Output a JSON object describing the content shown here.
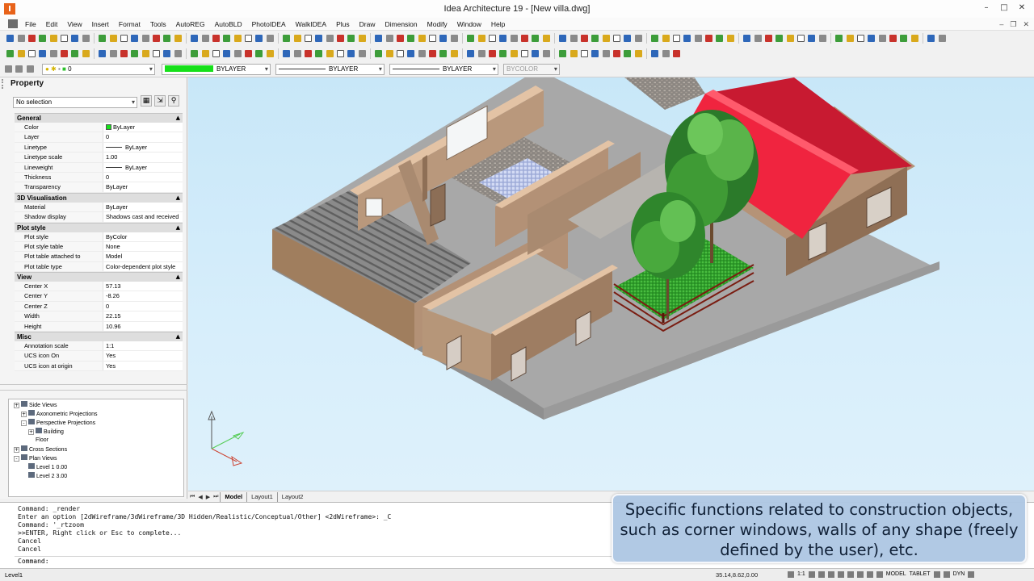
{
  "window": {
    "title": "Idea Architecture 19 - [New villa.dwg]",
    "logo_letter": "I"
  },
  "menu": [
    "File",
    "Edit",
    "View",
    "Insert",
    "Format",
    "Tools",
    "AutoREG",
    "AutoBLD",
    "PhotoIDEA",
    "WalkIDEA",
    "Plus",
    "Draw",
    "Dimension",
    "Modify",
    "Window",
    "Help"
  ],
  "propbar": {
    "layer": "0",
    "color": "BYLAYER",
    "linetype": "BYLAYER",
    "lineweight": "BYLAYER",
    "plotstyle": "BYCOLOR"
  },
  "property_panel": {
    "title": "Property",
    "selection": "No selection",
    "sections": [
      {
        "name": "General",
        "rows": [
          {
            "k": "Color",
            "v": "ByLayer",
            "type": "color"
          },
          {
            "k": "Layer",
            "v": "0"
          },
          {
            "k": "Linetype",
            "v": "ByLayer",
            "type": "line"
          },
          {
            "k": "Linetype scale",
            "v": "1.00"
          },
          {
            "k": "Lineweight",
            "v": "ByLayer",
            "type": "line"
          },
          {
            "k": "Thickness",
            "v": "0"
          },
          {
            "k": "Transparency",
            "v": "ByLayer"
          }
        ]
      },
      {
        "name": "3D Visualisation",
        "rows": [
          {
            "k": "Material",
            "v": "ByLayer"
          },
          {
            "k": "Shadow display",
            "v": "Shadows cast and received"
          }
        ]
      },
      {
        "name": "Plot style",
        "rows": [
          {
            "k": "Plot style",
            "v": "ByColor"
          },
          {
            "k": "Plot style table",
            "v": "None"
          },
          {
            "k": "Plot table attached to",
            "v": "Model"
          },
          {
            "k": "Plot table type",
            "v": "Color-dependent plot style"
          }
        ]
      },
      {
        "name": "View",
        "rows": [
          {
            "k": "Center X",
            "v": "57.13"
          },
          {
            "k": "Center Y",
            "v": "-8.26"
          },
          {
            "k": "Center Z",
            "v": "0"
          },
          {
            "k": "Width",
            "v": "22.15"
          },
          {
            "k": "Height",
            "v": "10.96"
          }
        ]
      },
      {
        "name": "Misc",
        "rows": [
          {
            "k": "Annotation scale",
            "v": "1:1"
          },
          {
            "k": "UCS icon On",
            "v": "Yes"
          },
          {
            "k": "UCS icon at origin",
            "v": "Yes"
          }
        ]
      }
    ]
  },
  "tree": [
    {
      "label": "Side Views",
      "level": 0,
      "expander": "+"
    },
    {
      "label": "Axonometric Projections",
      "level": 1,
      "expander": "+"
    },
    {
      "label": "Perspective Projections",
      "level": 1,
      "expander": "-"
    },
    {
      "label": "Building",
      "level": 2,
      "expander": "+"
    },
    {
      "label": "Floor",
      "level": 3,
      "expander": ""
    },
    {
      "label": "Cross Sections",
      "level": 0,
      "expander": "+"
    },
    {
      "label": "Plan Views",
      "level": 0,
      "expander": "-"
    },
    {
      "label": "Level 1  0.00",
      "level": 2,
      "expander": ""
    },
    {
      "label": "Level 2  3.00",
      "level": 2,
      "expander": ""
    }
  ],
  "layout_tabs": [
    "Model",
    "Layout1",
    "Layout2"
  ],
  "command_history": [
    "Command: _render",
    "Enter an option [2dWireframe/3dWireframe/3D Hidden/Realistic/Conceptual/Other] <2dWireframe>: _C",
    "Command: '_rtzoom",
    ">>ENTER, Right click or Esc to complete...",
    "Cancel",
    "Cancel"
  ],
  "command_prompt": "Command:",
  "caption": "Specific functions related to construction objects, such as corner windows, walls of any shape (freely defined by the user), etc.",
  "status": {
    "layer": "Level1",
    "coords": "35.14,8.62,0.00",
    "scale": "1:1",
    "model_label": "MODEL",
    "tablet_label": "TABLET",
    "dyn_label": "DYN"
  },
  "colors": {
    "roof": "#f0243f",
    "wall": "#c9a27f",
    "lawn": "#3fb53a",
    "sky": "#cde9f8",
    "caption_bg": "#aec7e3"
  }
}
